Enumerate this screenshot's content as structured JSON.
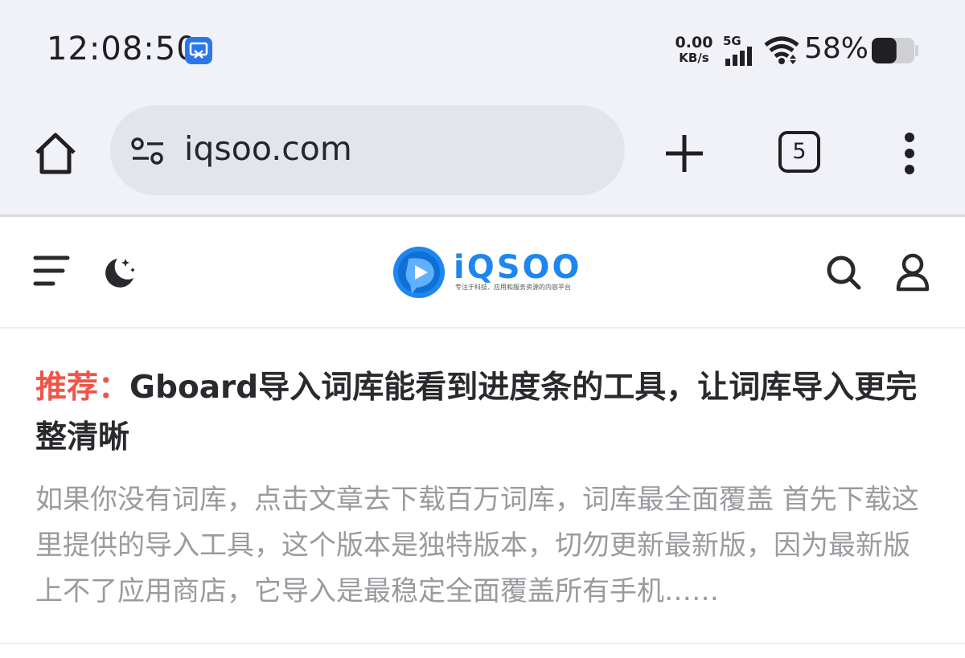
{
  "status_bar": {
    "time": "12:08:50",
    "net_speed_value": "0.00",
    "net_speed_unit": "KB/s",
    "network_type": "5G",
    "battery_percent": "58%",
    "battery_level": 0.58,
    "notification_icon": "screenshot-app-icon"
  },
  "browser": {
    "url": "iqsoo.com",
    "tab_count": "5",
    "icons": {
      "home": "home-icon",
      "site_info": "tune-icon",
      "new_tab": "plus-icon",
      "tabs": "tab-switcher-icon",
      "menu": "more-vertical-icon"
    }
  },
  "site": {
    "logo_text": "iQSOO",
    "logo_tagline": "专注于科技、应用和服务资源的内容平台",
    "brand_color": "#1e86f0",
    "icons": {
      "menu": "hamburger-icon",
      "dark_mode": "moon-icon",
      "search": "search-icon",
      "user": "user-icon"
    }
  },
  "article": {
    "tag": "推荐：",
    "title": "Gboard导入词库能看到进度条的工具，让词库导入更完整清晰",
    "excerpt": "如果你没有词库，点击文章去下载百万词库，词库最全面覆盖 首先下载这里提供的导入工具，这个版本是独特版本，切勿更新最新版，因为最新版上不了应用商店，它导入是最稳定全面覆盖所有手机……",
    "tag_color": "#f05548"
  }
}
